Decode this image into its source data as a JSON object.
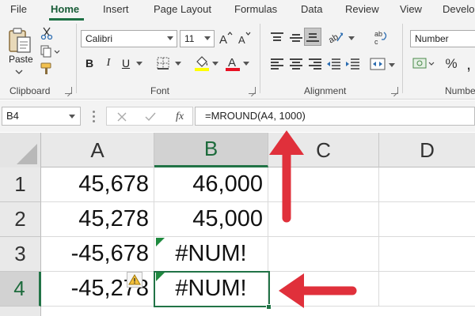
{
  "menu": {
    "tabs": [
      {
        "label": "File"
      },
      {
        "label": "Home",
        "active": true
      },
      {
        "label": "Insert"
      },
      {
        "label": "Page Layout"
      },
      {
        "label": "Formulas"
      },
      {
        "label": "Data"
      },
      {
        "label": "Review"
      },
      {
        "label": "View"
      },
      {
        "label": "Develo"
      }
    ]
  },
  "ribbon": {
    "clipboard": {
      "label": "Clipboard",
      "paste_label": "Paste"
    },
    "font": {
      "label": "Font",
      "font_name": "Calibri",
      "font_size": "11",
      "fill_color": "#ffff00",
      "font_color": "#e81123"
    },
    "alignment": {
      "label": "Alignment"
    },
    "number": {
      "label": "Numbe",
      "format": "Number"
    }
  },
  "formula_bar": {
    "name_box": "B4",
    "formula": "=MROUND(A4, 1000)",
    "fx_label": "fx"
  },
  "sheet": {
    "columns": [
      "A",
      "B",
      "C",
      "D"
    ],
    "selected_column": "B",
    "rows": [
      {
        "header": "1",
        "a": "45,678",
        "b": "46,000"
      },
      {
        "header": "2",
        "a": "45,278",
        "b": "45,000"
      },
      {
        "header": "3",
        "a": "-45,678",
        "b": "#NUM!"
      },
      {
        "header": "4",
        "a": "-45,278",
        "b": "#NUM!"
      }
    ],
    "selected_row": "4",
    "colors": {
      "selection": "#217346",
      "error_triangle": "#1e8a3e",
      "arrow": "#e0303b"
    }
  }
}
